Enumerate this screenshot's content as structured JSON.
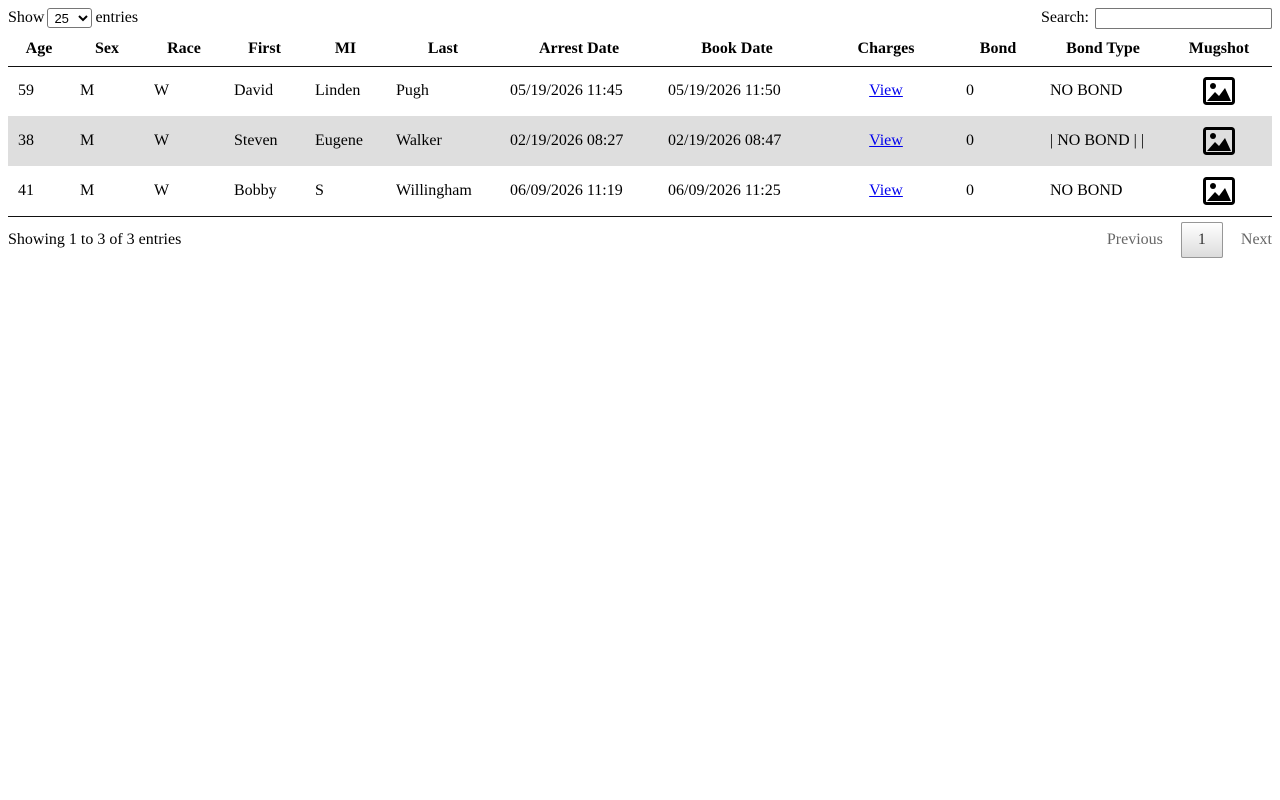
{
  "controls": {
    "show_label": "Show",
    "entries_label": "entries",
    "length_selected": "25",
    "search_label": "Search:",
    "search_value": ""
  },
  "table": {
    "headers": [
      "Age",
      "Sex",
      "Race",
      "First",
      "MI",
      "Last",
      "Arrest Date",
      "Book Date",
      "Charges",
      "Bond",
      "Bond Type",
      "Mugshot"
    ],
    "rows": [
      {
        "age": "59",
        "sex": "M",
        "race": "W",
        "first": "David",
        "mi": "Linden",
        "last": "Pugh",
        "arrest_date": "05/19/2026 11:45",
        "book_date": "05/19/2026 11:50",
        "charges": "View",
        "bond": "0",
        "bond_type": "NO BOND",
        "mugshot_icon": "image-icon"
      },
      {
        "age": "38",
        "sex": "M",
        "race": "W",
        "first": "Steven",
        "mi": "Eugene",
        "last": "Walker",
        "arrest_date": "02/19/2026 08:27",
        "book_date": "02/19/2026 08:47",
        "charges": "View",
        "bond": "0",
        "bond_type": "| NO BOND | |",
        "mugshot_icon": "image-icon"
      },
      {
        "age": "41",
        "sex": "M",
        "race": "W",
        "first": "Bobby",
        "mi": "S",
        "last": "Willingham",
        "arrest_date": "06/09/2026 11:19",
        "book_date": "06/09/2026 11:25",
        "charges": "View",
        "bond": "0",
        "bond_type": "NO BOND",
        "mugshot_icon": "image-icon"
      }
    ]
  },
  "footer": {
    "info": "Showing 1 to 3 of 3 entries",
    "previous": "Previous",
    "current_page": "1",
    "next": "Next"
  }
}
